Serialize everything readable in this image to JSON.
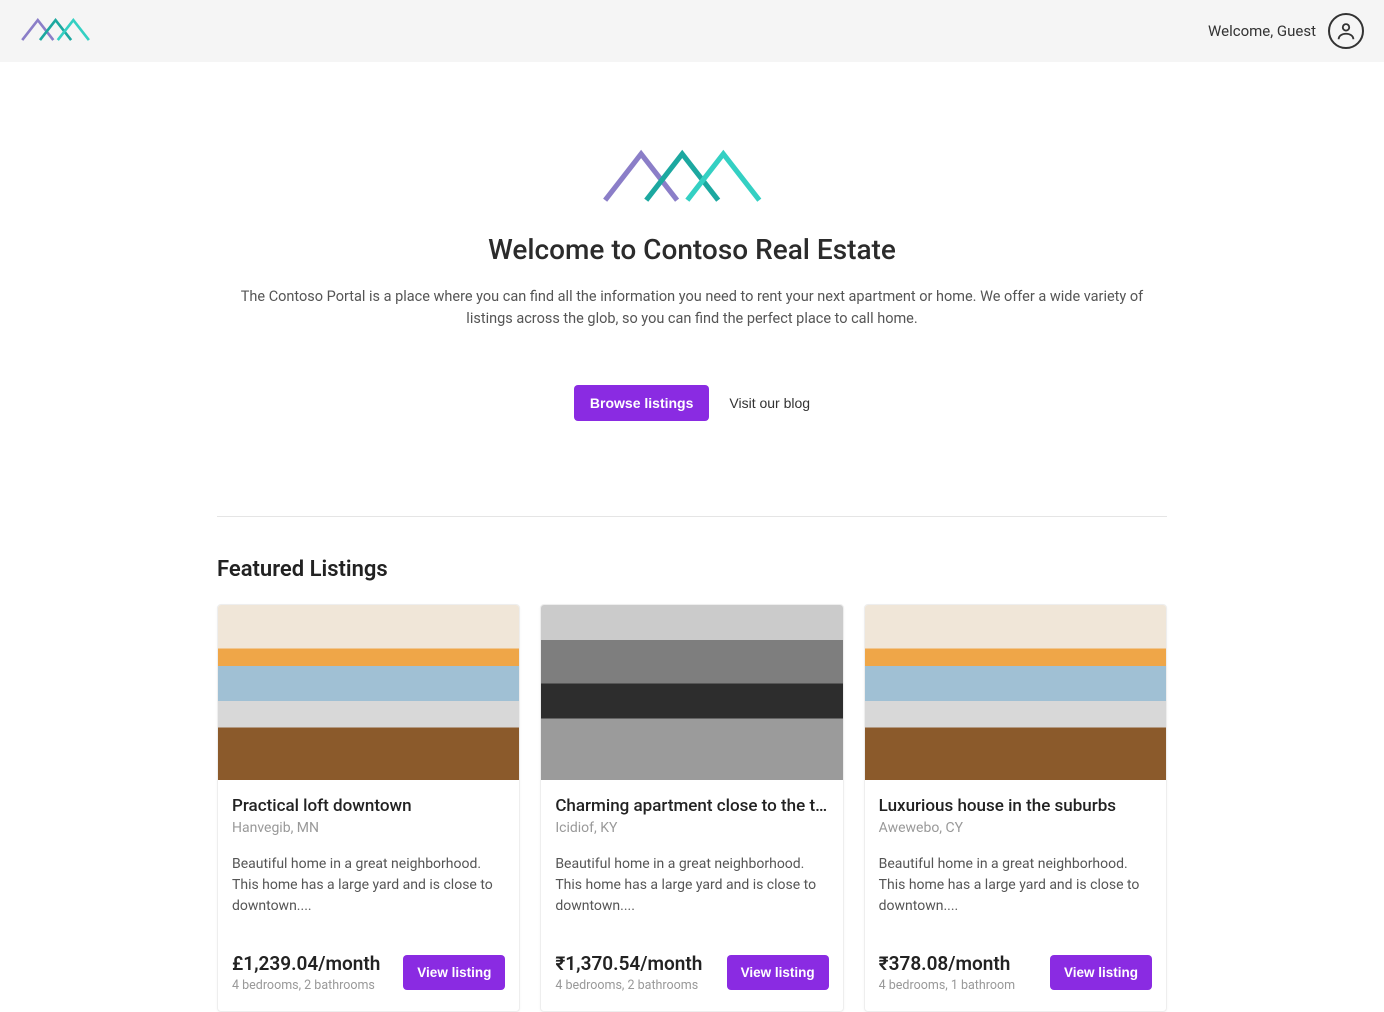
{
  "header": {
    "welcome": "Welcome, Guest"
  },
  "hero": {
    "title": "Welcome to Contoso Real Estate",
    "description": "The Contoso Portal is a place where you can find all the information you need to rent your next apartment or home. We offer a wide variety of listings across the glob, so you can find the perfect place to call home.",
    "browse_label": "Browse listings",
    "blog_label": "Visit our blog"
  },
  "featured": {
    "title": "Featured Listings",
    "view_label": "View listing",
    "items": [
      {
        "title": "Practical loft downtown",
        "location": "Hanvegib, MN",
        "description": "Beautiful home in a great neighborhood. This home has a large yard and is close to downtown....",
        "price": "£1,239.04/month",
        "meta": "4 bedrooms, 2 bathrooms"
      },
      {
        "title": "Charming apartment close to the t…",
        "location": "Icidiof, KY",
        "description": "Beautiful home in a great neighborhood. This home has a large yard and is close to downtown....",
        "price": "₹1,370.54/month",
        "meta": "4 bedrooms, 2 bathrooms"
      },
      {
        "title": "Luxurious house in the suburbs",
        "location": "Awewebo, CY",
        "description": "Beautiful home in a great neighborhood. This home has a large yard and is close to downtown....",
        "price": "₹378.08/month",
        "meta": "4 bedrooms, 1 bathroom"
      }
    ]
  }
}
